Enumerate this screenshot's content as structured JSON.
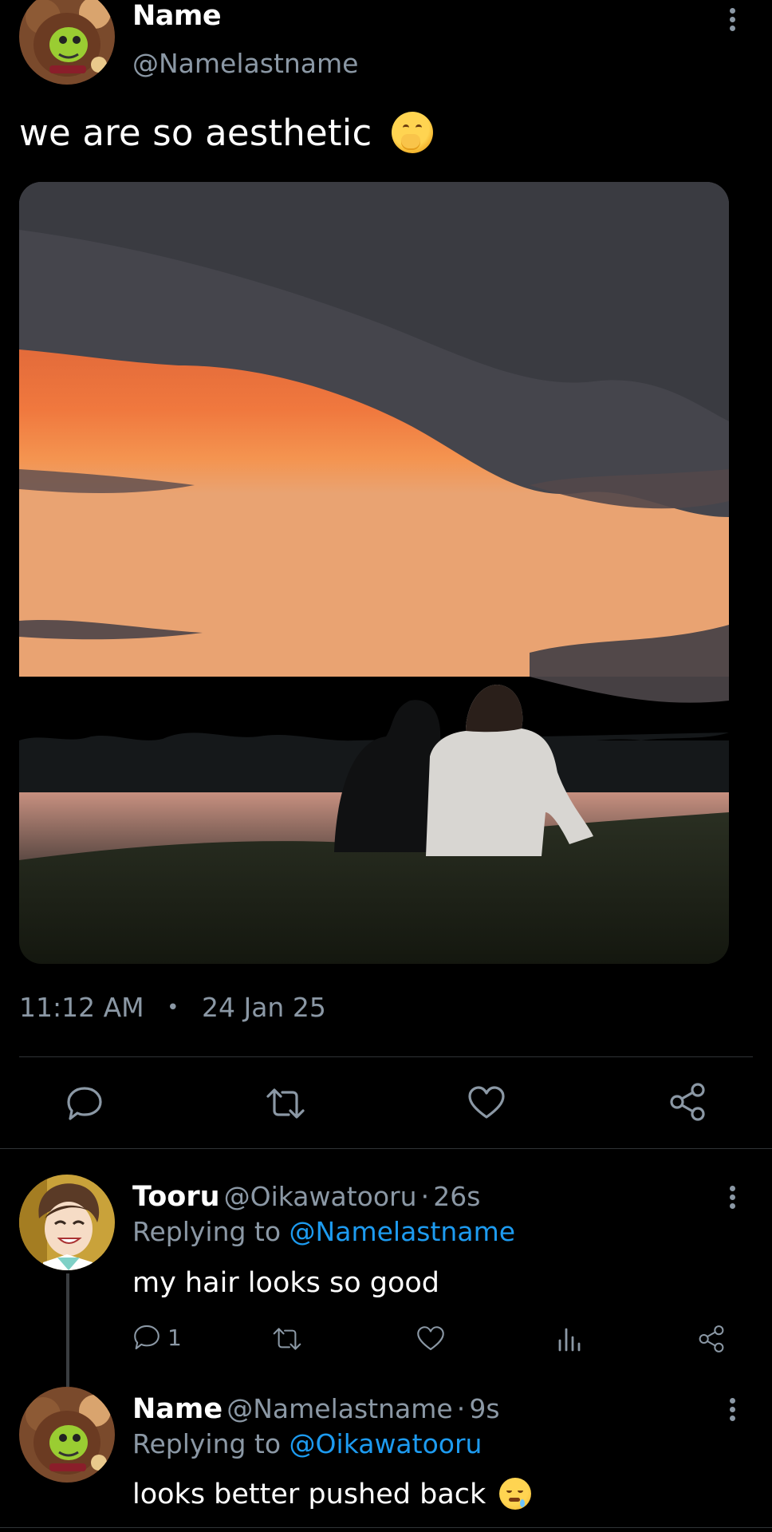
{
  "tweet": {
    "author_name": "Name",
    "author_handle": "@Namelastname",
    "text": "we are so aesthetic",
    "emoji": "hand-over-mouth-emoji",
    "time": "11:12 AM",
    "separator": "•",
    "date": "24 Jan 25"
  },
  "actions": [
    "reply-icon",
    "retweet-icon",
    "like-icon",
    "share-icon"
  ],
  "replies": [
    {
      "name": "Tooru",
      "handle": "@Oikawatooru",
      "sep": "·",
      "age": "26s",
      "replying_prefix": "Replying to",
      "replying_to": "@Namelastname",
      "text": "my hair looks so good",
      "reply_count": "1"
    },
    {
      "name": "Name",
      "handle": "@Namelastname",
      "sep": "·",
      "age": "9s",
      "replying_prefix": "Replying to",
      "replying_to": "@Oikawatooru",
      "text": "looks better pushed back"
    }
  ],
  "colors": {
    "background": "#000000",
    "muted": "#8b98a5",
    "link": "#1d9bf0",
    "divider": "#2f3336"
  }
}
